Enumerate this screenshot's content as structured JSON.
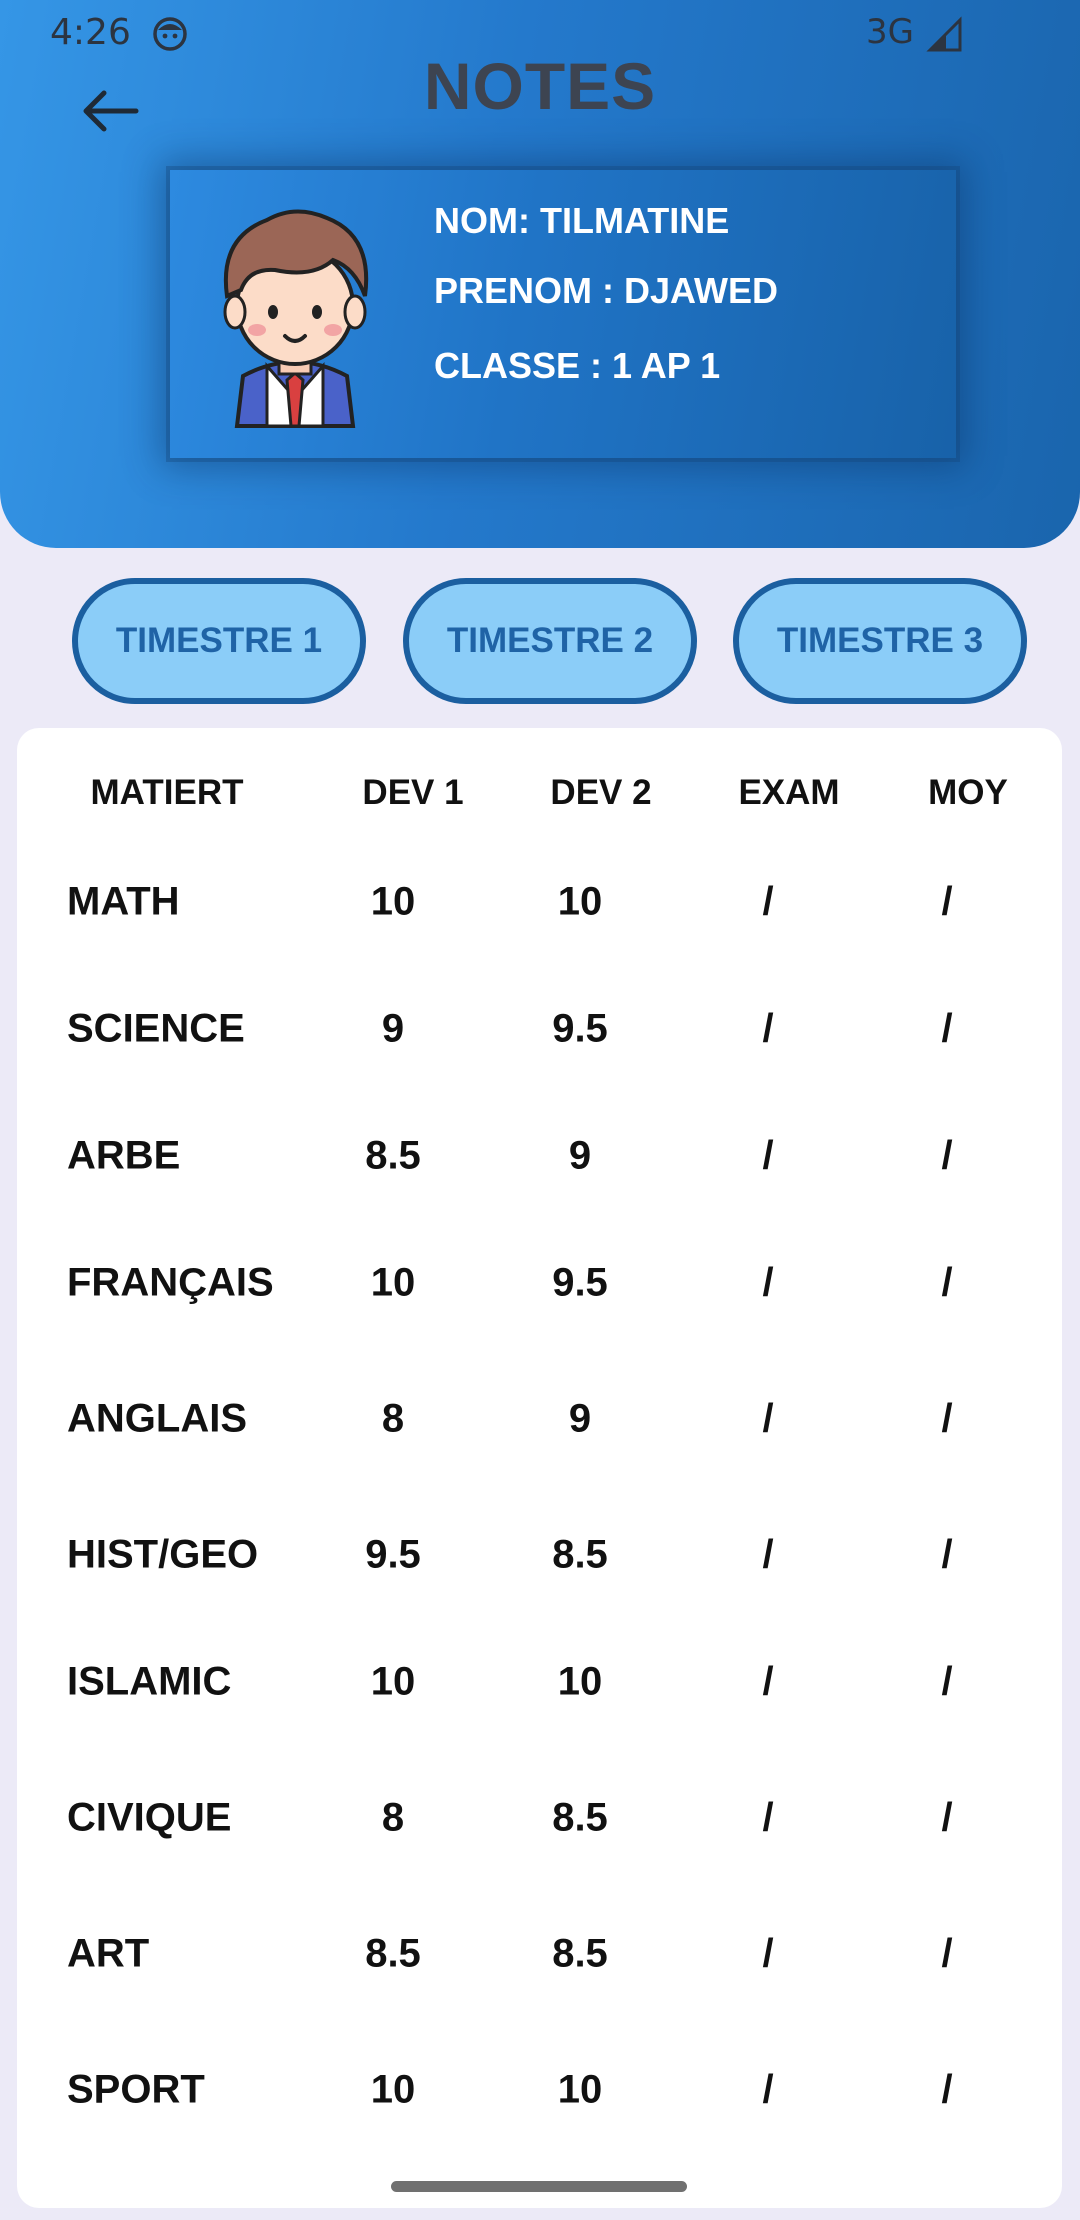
{
  "status_bar": {
    "time": "4:26",
    "network": "3G"
  },
  "header": {
    "title": "NOTES",
    "student": {
      "name": "NOM: TILMATINE",
      "firstname": "PRENOM : DJAWED",
      "class": "CLASSE : 1 AP 1"
    }
  },
  "tabs": [
    {
      "label": "TIMESTRE 1"
    },
    {
      "label": "TIMESTRE 2"
    },
    {
      "label": "TIMESTRE 3"
    }
  ],
  "table": {
    "headers": [
      "MATIERT",
      "DEV 1",
      "DEV 2",
      "EXAM",
      "MOY"
    ],
    "rows": [
      [
        "MATH",
        "10",
        "10",
        "/",
        "/"
      ],
      [
        "SCIENCE",
        "9",
        "9.5",
        "/",
        "/"
      ],
      [
        "ARBE",
        "8.5",
        "9",
        "/",
        "/"
      ],
      [
        "FRANÇAIS",
        "10",
        "9.5",
        "/",
        "/"
      ],
      [
        "ANGLAIS",
        "8",
        "9",
        "/",
        "/"
      ],
      [
        "HIST/GEO",
        "9.5",
        "8.5",
        "/",
        "/"
      ],
      [
        "ISLAMIC",
        "10",
        "10",
        "/",
        "/"
      ],
      [
        "CIVIQUE",
        "8",
        "8.5",
        "/",
        "/"
      ],
      [
        "ART",
        "8.5",
        "8.5",
        "/",
        "/"
      ],
      [
        "SPORT",
        "10",
        "10",
        "/",
        "/"
      ]
    ]
  },
  "icons": {
    "back": "arrow-left-icon",
    "status_face": "face-icon",
    "signal": "signal-icon",
    "avatar": "student-avatar"
  },
  "colors": {
    "header_gradient_start": "#3596e6",
    "header_gradient_end": "#1a65ad",
    "tab_fill": "#8bcdf8",
    "tab_border": "#1b5fa0",
    "title_text": "#3d4451"
  }
}
